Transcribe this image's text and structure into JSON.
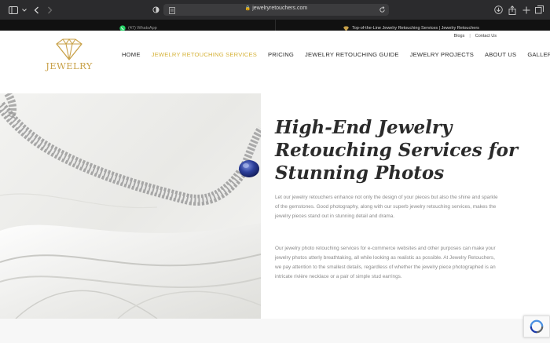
{
  "browser": {
    "url": "jewelryretouchers.com"
  },
  "topbar": {
    "whatsapp_label": "(47) WhatsApp",
    "promo_text": "Top-of-the-Line Jewelry Retouching Services | Jewelry Retouchers"
  },
  "header": {
    "utility_links": [
      "Blogs",
      "Contact Us"
    ],
    "logo_text": "JEWELRY",
    "nav": [
      {
        "label": "HOME",
        "active": false
      },
      {
        "label": "JEWELRY RETOUCHING SERVICES",
        "active": true
      },
      {
        "label": "PRICING",
        "active": false
      },
      {
        "label": "JEWELRY RETOUCHING GUIDE",
        "active": false
      },
      {
        "label": "JEWELRY PROJECTS",
        "active": false
      },
      {
        "label": "ABOUT US",
        "active": false
      },
      {
        "label": "GALLERY",
        "active": false
      }
    ]
  },
  "hero": {
    "title": "High-End Jewelry Retouching Services for Stunning Photos",
    "paragraph1": "Let our jewelry retouchers enhance not only the design of your pieces but also the shine and sparkle of the gemstones. Good photography, along with our superb jewelry retouching services, makes the jewelry pieces stand out in stunning detail and drama.",
    "paragraph2": "Our jewelry photo retouching services for e-commerce websites and other purposes can make your jewelry photos utterly breathtaking, all while looking as realistic as possible. At Jewelry Retouchers, we pay attention to the smallest details, regardless of whether the jewelry piece photographed is an intricate rivière necklace or a pair of simple stud earrings."
  },
  "colors": {
    "gold": "#d6b33b",
    "logo_gold": "#c9a24a",
    "sapphire": "#2c3f9a",
    "whatsapp_green": "#25d366"
  }
}
